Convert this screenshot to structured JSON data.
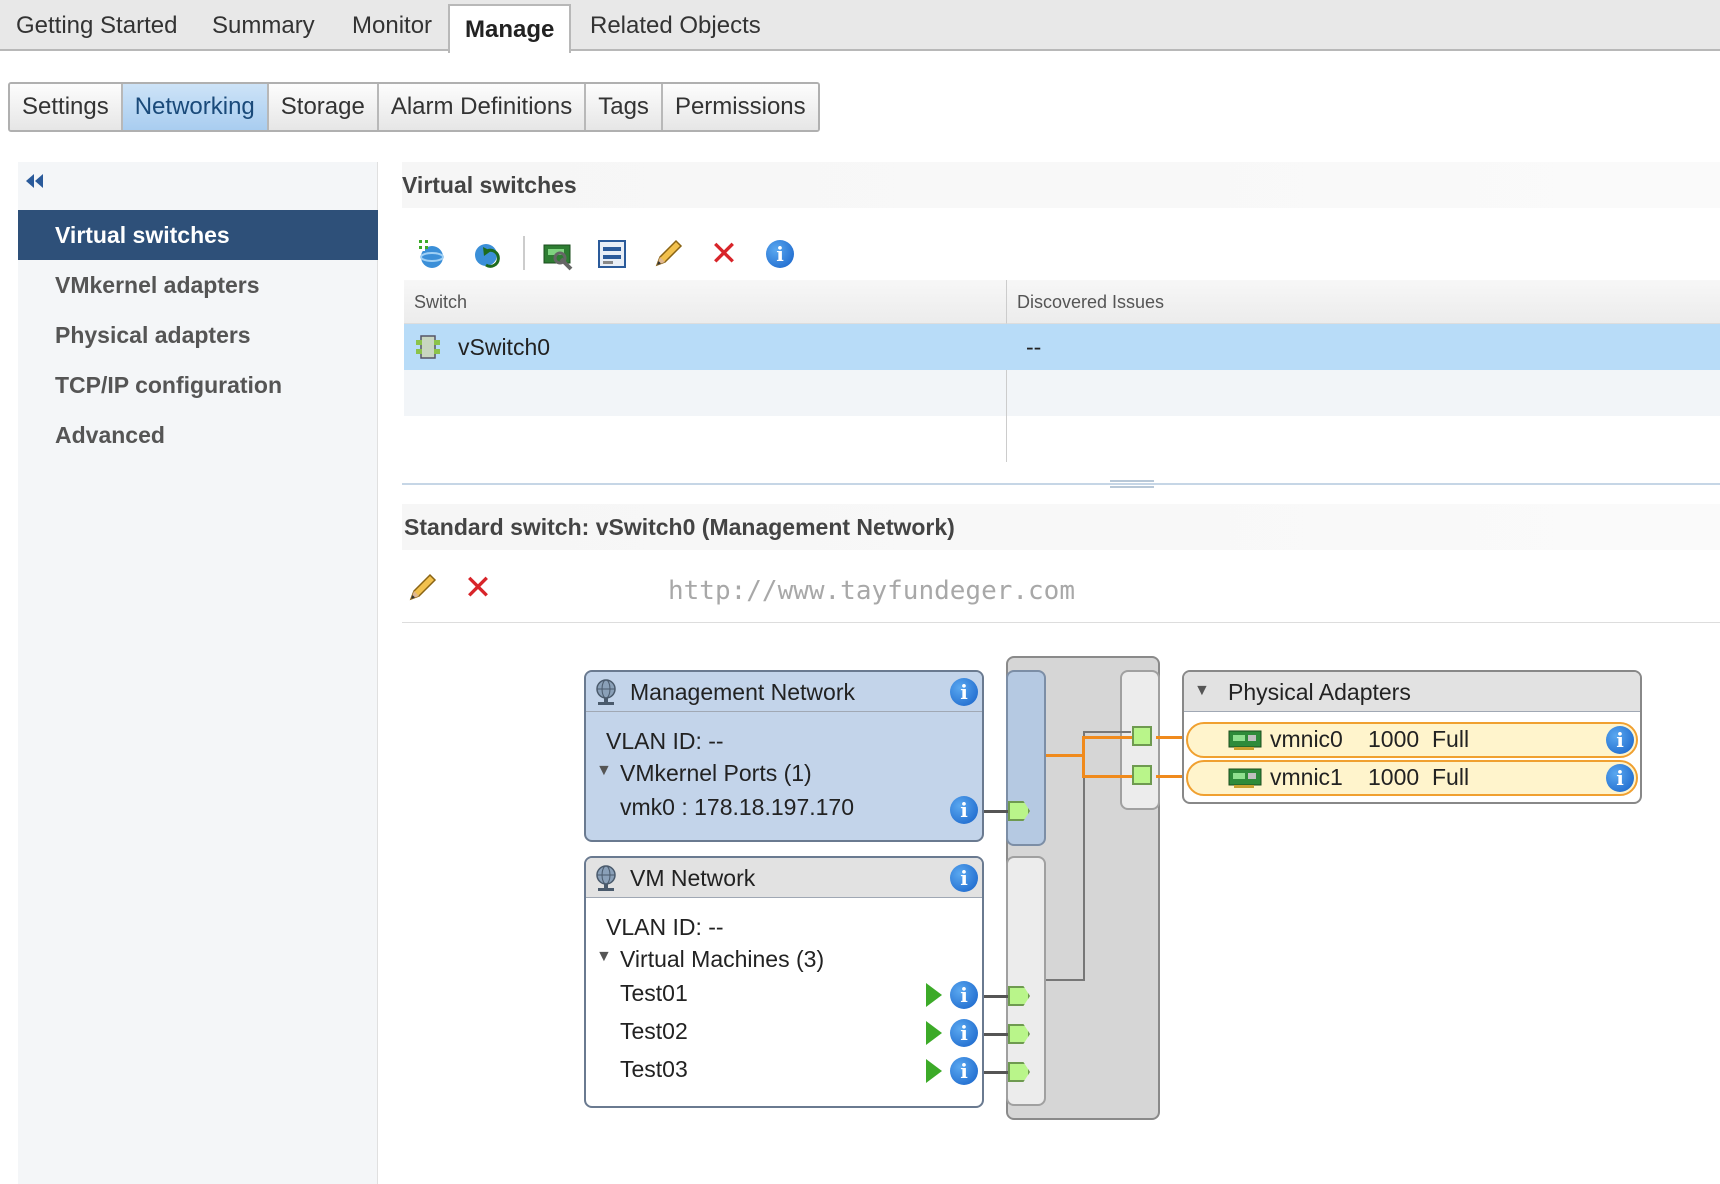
{
  "top_tabs": [
    "Getting Started",
    "Summary",
    "Monitor",
    "Manage",
    "Related Objects"
  ],
  "sub_tabs": [
    "Settings",
    "Networking",
    "Storage",
    "Alarm Definitions",
    "Tags",
    "Permissions"
  ],
  "sidebar": {
    "collapse_icon": "double-chevron-left-icon",
    "items": [
      "Virtual switches",
      "VMkernel adapters",
      "Physical adapters",
      "TCP/IP configuration",
      "Advanced"
    ]
  },
  "virtual_switches": {
    "title": "Virtual switches",
    "columns": [
      "Switch",
      "Discovered Issues"
    ],
    "rows": [
      {
        "switch": "vSwitch0",
        "issues": "--"
      }
    ]
  },
  "standard_switch": {
    "title": "Standard switch: vSwitch0 (Management Network)",
    "watermark": "http://www.tayfundeger.com"
  },
  "diagram": {
    "management": {
      "title": "Management Network",
      "vlan": "VLAN ID: --",
      "ports_label": "VMkernel Ports (1)",
      "vmk": "vmk0 : 178.18.197.170"
    },
    "vm_network": {
      "title": "VM Network",
      "vlan": "VLAN ID: --",
      "vms_label": "Virtual Machines (3)",
      "vms": [
        "Test01",
        "Test02",
        "Test03"
      ]
    },
    "physical": {
      "title": "Physical Adapters",
      "nics": [
        {
          "name": "vmnic0",
          "speed": "1000",
          "duplex": "Full"
        },
        {
          "name": "vmnic1",
          "speed": "1000",
          "duplex": "Full"
        }
      ]
    }
  },
  "colors": {
    "sidebar_active": "#2e5079",
    "row_selected": "#b8dcf8",
    "uplink_orange": "#f08a1c",
    "port_green": "#b9f58a"
  }
}
